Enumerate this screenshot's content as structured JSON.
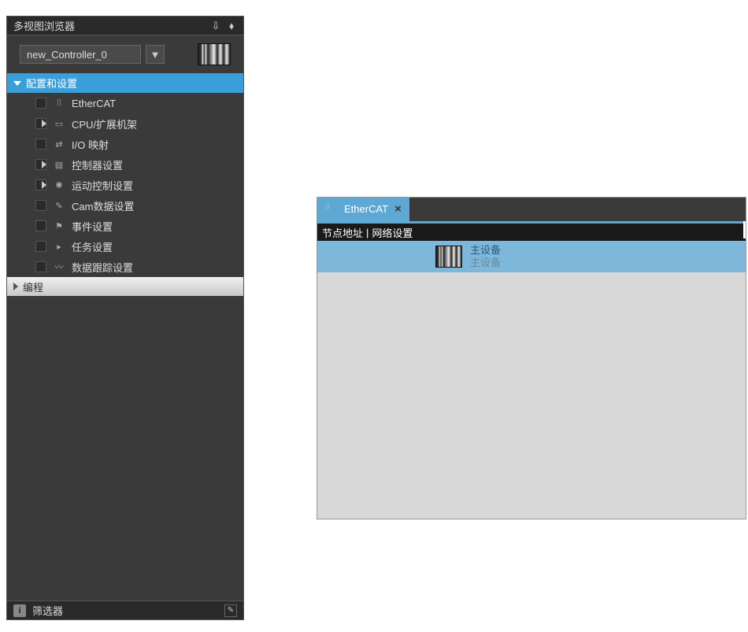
{
  "sidebar": {
    "title": "多视图浏览器",
    "controller": {
      "selected": "new_Controller_0"
    },
    "tree": {
      "config_section": "配置和设置",
      "items": [
        {
          "label": "EtherCAT",
          "expandable": false,
          "icon": "ethercat"
        },
        {
          "label": "CPU/扩展机架",
          "expandable": true,
          "icon": "cpu"
        },
        {
          "label": "I/O 映射",
          "expandable": false,
          "icon": "io"
        },
        {
          "label": "控制器设置",
          "expandable": true,
          "icon": "controller"
        },
        {
          "label": "运动控制设置",
          "expandable": true,
          "icon": "motion"
        },
        {
          "label": "Cam数据设置",
          "expandable": false,
          "icon": "cam"
        },
        {
          "label": "事件设置",
          "expandable": false,
          "icon": "event"
        },
        {
          "label": "任务设置",
          "expandable": false,
          "icon": "task"
        },
        {
          "label": "数据跟踪设置",
          "expandable": false,
          "icon": "trace"
        }
      ],
      "programming_section": "编程"
    },
    "footer": {
      "filter_label": "筛选器"
    }
  },
  "right_panel": {
    "tab": {
      "label": "EtherCAT"
    },
    "columns": {
      "node_addr": "节点地址",
      "network_config": "网络设置"
    },
    "device": {
      "primary": "主设备",
      "secondary": "主设备"
    }
  }
}
